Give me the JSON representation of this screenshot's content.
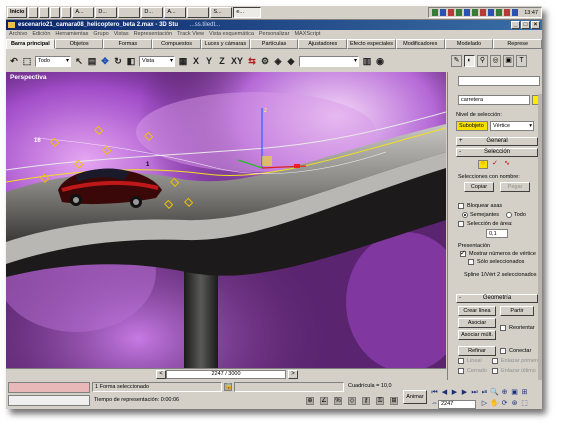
{
  "taskbar": {
    "start_label": "Inicio",
    "buttons": [
      "",
      "",
      "",
      "",
      "A...",
      "D...",
      "",
      "D...",
      "A...",
      "",
      "S...",
      "e..."
    ],
    "clock": "13:47"
  },
  "window": {
    "title": "escenario21_camara08_helicoptero_beta 2.max - 3D Stu",
    "title_suffix": "...ss.tiledt..."
  },
  "menu": [
    "Archivo",
    "Edición",
    "Herramientas",
    "Grupo",
    "Vistas",
    "Representación",
    "Track View",
    "Vista esquemática",
    "Personalizar",
    "MAXScript"
  ],
  "tabs": [
    {
      "label": "Barra principal",
      "selected": true
    },
    {
      "label": "Objetos",
      "selected": false
    },
    {
      "label": "Formas",
      "selected": false
    },
    {
      "label": "Compuestos",
      "selected": false
    },
    {
      "label": "Luces y cámaras",
      "selected": false
    },
    {
      "label": "Partículas",
      "selected": false
    },
    {
      "label": "Ajustadores",
      "selected": false
    },
    {
      "label": "Efecto especiales",
      "selected": false
    },
    {
      "label": "Modificadores",
      "selected": false
    },
    {
      "label": "Modelado",
      "selected": false
    },
    {
      "label": "Represe",
      "selected": false
    }
  ],
  "toolbar": {
    "filter_select": "Todo",
    "view_select": "Vista",
    "axis_labels": [
      "X",
      "Y",
      "Z",
      "XY"
    ],
    "right_select": "Vista"
  },
  "viewport": {
    "label": "Perspectiva",
    "axis_z": "z",
    "vertex_numbers": [
      "1",
      "16"
    ]
  },
  "time": {
    "slider_text": "2247 / 3000",
    "prev": "<",
    "next": ">"
  },
  "status": {
    "selection_text": "1 Forma seleccionado",
    "render_time_label": "Tiempo de representación: 0:00:06",
    "grid_label": "Cuadrícula = 10,0",
    "animate_label": "Animar",
    "current_frame": "2247"
  },
  "panel": {
    "object_name": "carretera",
    "selection_level_label": "Nivel de selección:",
    "sub_object_label": "Subobjeto",
    "sub_object_value": "Vértice",
    "rollouts": {
      "general": "General",
      "selection": "Selección",
      "geometry": "Geometría"
    },
    "named_selections_label": "Selecciones con nombre:",
    "copy_button": "Copiar",
    "paste_button": "Pegar",
    "lock_handles_label": "Bloquear asas",
    "similar_label": "Semejantes",
    "all_label": "Todo",
    "area_select_label": "Selección de área:",
    "area_value": "0,1",
    "display_label": "Presentación",
    "show_vertex_numbers_label": "Mostrar números de vértice",
    "only_selected_label": "Sólo seleccionados",
    "spline_info": "Spline 1/Vért 2 seleccionados",
    "create_line_button": "Crear línea",
    "break_button": "Partir",
    "attach_button": "Asociar",
    "attach_multi_button": "Asociar múlt.",
    "reorient_label": "Reorientar",
    "refine_button": "Refinar",
    "connect_label": "Conectar",
    "linear_label": "Lineal",
    "bind_first_label": "Enlazar primero",
    "closed_label": "Cerrado",
    "bind_last_label": "Enlazar último"
  },
  "colors": {
    "title_gradient_start": "#0a246a",
    "title_gradient_end": "#3a6ea5",
    "ui_gray": "#d4d0c8",
    "highlight_yellow": "#f6e000",
    "status_pink": "#e8b8b8"
  }
}
